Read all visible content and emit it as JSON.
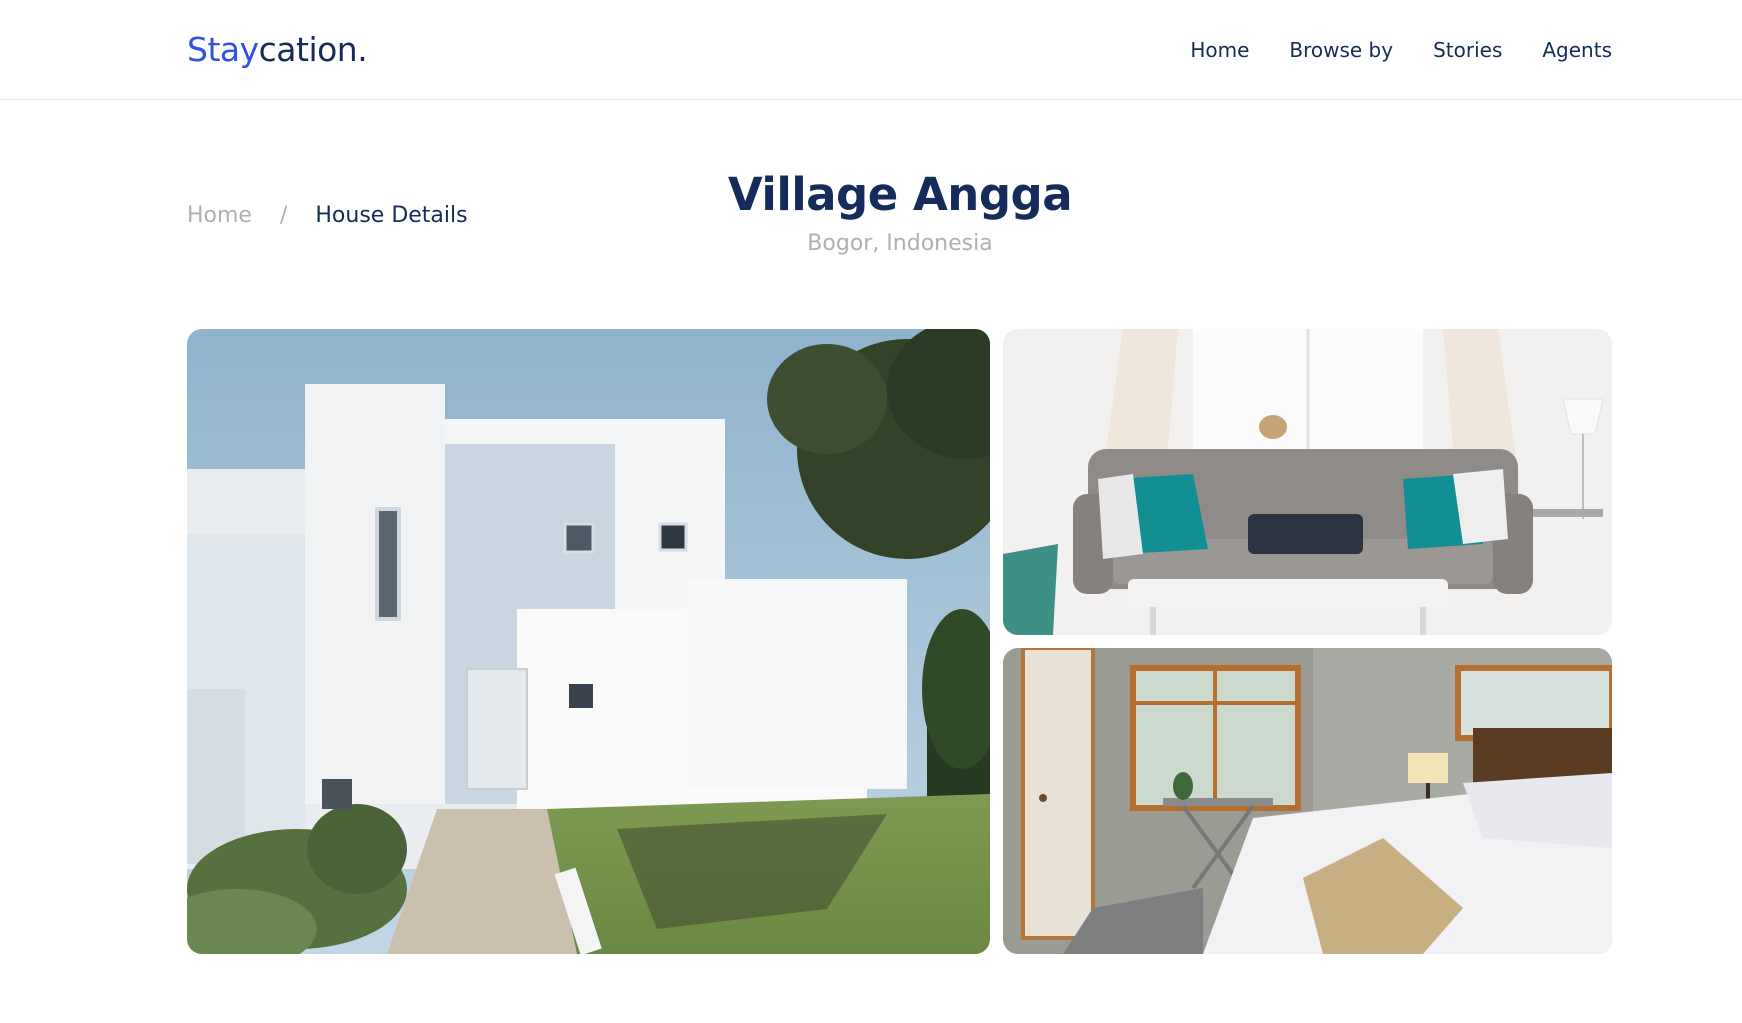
{
  "brand": {
    "accent": "Stay",
    "rest": "cation."
  },
  "nav": {
    "items": [
      {
        "label": "Home"
      },
      {
        "label": "Browse by"
      },
      {
        "label": "Stories"
      },
      {
        "label": "Agents"
      }
    ]
  },
  "breadcrumb": {
    "home": "Home",
    "separator": "/",
    "current": "House Details"
  },
  "property": {
    "name": "Village Angga",
    "location": "Bogor, Indonesia"
  },
  "gallery": {
    "images": [
      {
        "subject": "white-modern-house-exterior"
      },
      {
        "subject": "living-room-sofa"
      },
      {
        "subject": "bedroom-interior"
      }
    ]
  },
  "colors": {
    "primary_text": "#152c5b",
    "brand_accent": "#3252df",
    "muted_text": "#b0b0b0",
    "divider": "#e5e5e5"
  }
}
